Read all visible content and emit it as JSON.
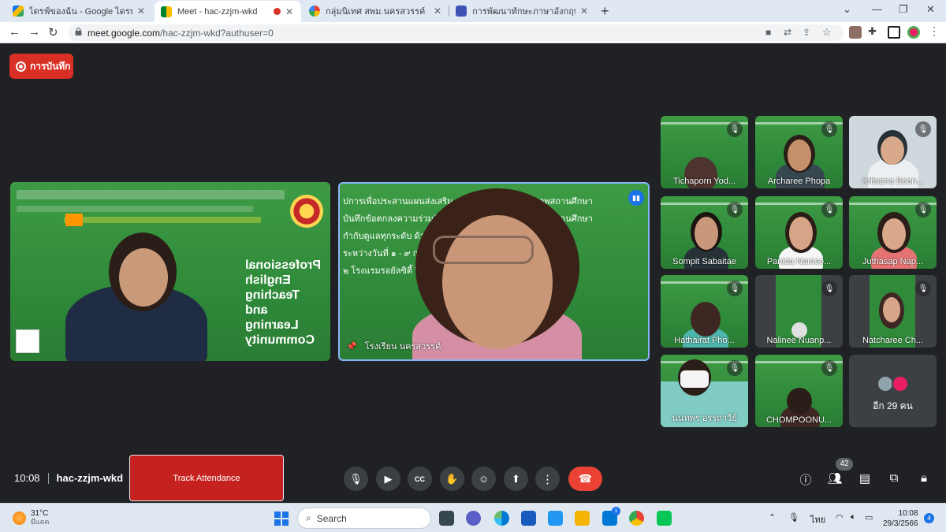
{
  "browser": {
    "tabs": [
      {
        "title": "ไดรฟ์ของฉัน - Google ไดรฟ์",
        "favicon": "drive-icon"
      },
      {
        "title": "Meet - hac-zzjm-wkd",
        "favicon": "meet-icon",
        "active": true
      },
      {
        "title": "กลุ่มนิเทศ สพม.นครสวรรค์",
        "favicon": "group-icon"
      },
      {
        "title": "การพัฒนาทักษะภาษาอังกฤษ English",
        "favicon": "forms-icon"
      }
    ],
    "url_host": "meet.google.com",
    "url_path": "/hac-zzjm-wkd?authuser=0"
  },
  "meet": {
    "recording_label": "การบันทึก",
    "presenter_slide": {
      "title_lines": [
        "Professional",
        "English",
        "Teaching",
        "and",
        "Learning",
        "Community"
      ]
    },
    "main_speaker": {
      "name": "โรงเรียน นครสวรรค์",
      "announcement_lines": [
        "ปการเพื่อประสานแผนส่งเสริม",
        "บันทึกข้อตกลงความร่วมมื",
        "กำกับดูแลทุกระดับ ด้วย",
        "ระหว่างวันที่ ๑ - ๙ กรกฎาค",
        "๒ โรงแรมรอยัลซิตี้ ปิ่นเก"
      ],
      "announcement_right": [
        "ภาพสถานศึกษา",
        "ภาพสถานศึกษา"
      ]
    },
    "participants": [
      {
        "name": "Tichaporn Yod...",
        "muted": true
      },
      {
        "name": "Archaree Phopa",
        "muted": true
      },
      {
        "name": "Kritsana Boon...",
        "muted": true
      },
      {
        "name": "Sompit Sabaitae",
        "muted": true
      },
      {
        "name": "Panida Namso...",
        "muted": true
      },
      {
        "name": "Juthasap Nap...",
        "muted": true
      },
      {
        "name": "Hathairat Pho...",
        "muted": true
      },
      {
        "name": "Nalinee Nuanp...",
        "muted": true
      },
      {
        "name": "Natcharee Ch...",
        "muted": true
      },
      {
        "name": "นนทพร อรรถาวีย์",
        "muted": true
      },
      {
        "name": "CHOMPOONU...",
        "muted": true
      }
    ],
    "more_participants": "อีก 29 คน",
    "time": "10:08",
    "meeting_code": "hac-zzjm-wkd",
    "track_attendance_label": "Track Attendance",
    "people_count": "42"
  },
  "taskbar": {
    "temperature": "31°C",
    "weather": "มีแดด",
    "search_placeholder": "Search",
    "language": "ไทย",
    "clock_time": "10:08",
    "clock_date": "29/3/2566",
    "notification_count": "4",
    "mail_badge": "1"
  },
  "colors": {
    "meet_bg": "#202124",
    "slide_green": "#2f8a3a",
    "end_call": "#ea4335",
    "recording": "#d93025"
  }
}
